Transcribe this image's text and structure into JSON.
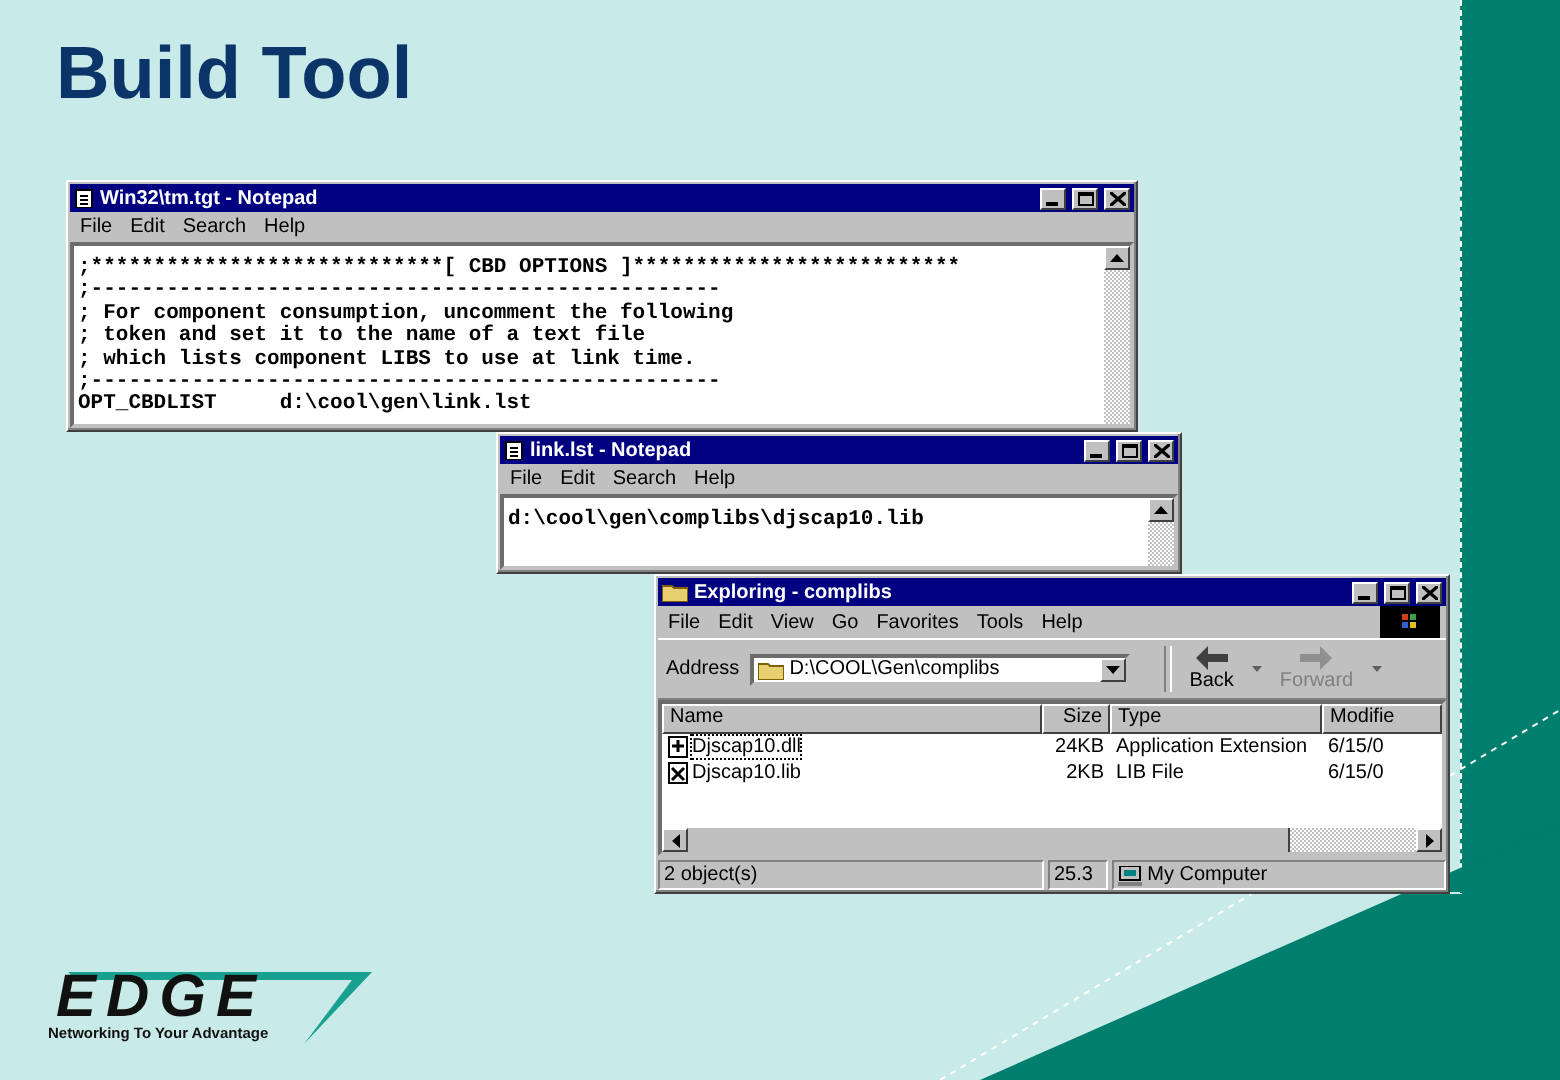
{
  "slide_title": "Build Tool",
  "windows": [
    {
      "kind": "notepad",
      "title": "Win32\\tm.tgt - Notepad",
      "menu": [
        "File",
        "Edit",
        "Search",
        "Help"
      ],
      "lines": [
        ";****************************[ CBD OPTIONS ]**************************",
        ";--------------------------------------------------",
        "; For component consumption, uncomment the following",
        "; token and set it to the name of a text file",
        "; which lists component LIBS to use at link time.",
        ";--------------------------------------------------",
        "OPT_CBDLIST     d:\\cool\\gen\\link.lst"
      ]
    },
    {
      "kind": "notepad",
      "title": "link.lst - Notepad",
      "menu": [
        "File",
        "Edit",
        "Search",
        "Help"
      ],
      "lines": [
        "d:\\cool\\gen\\complibs\\djscap10.lib"
      ]
    },
    {
      "kind": "explorer",
      "title": "Exploring - complibs",
      "menu": [
        "File",
        "Edit",
        "View",
        "Go",
        "Favorites",
        "Tools",
        "Help"
      ],
      "address_label": "Address",
      "address": "D:\\COOL\\Gen\\complibs",
      "nav": [
        {
          "label": "Back",
          "disabled": false
        },
        {
          "label": "Forward",
          "disabled": true
        }
      ],
      "columns": [
        "Name",
        "Size",
        "Type",
        "Modifie"
      ],
      "rows": [
        {
          "cells": [
            "Djscap10.dll",
            "24KB",
            "Application Extension",
            "6/15/0"
          ],
          "focused": true
        },
        {
          "cells": [
            "Djscap10.lib",
            "2KB",
            "LIB File",
            "6/15/0"
          ],
          "focused": false
        }
      ],
      "status": [
        "2 object(s)",
        "25.3",
        "My Computer"
      ]
    }
  ],
  "logo": {
    "wordmark": "EDGE",
    "tagline": "Networking To Your Advantage"
  }
}
